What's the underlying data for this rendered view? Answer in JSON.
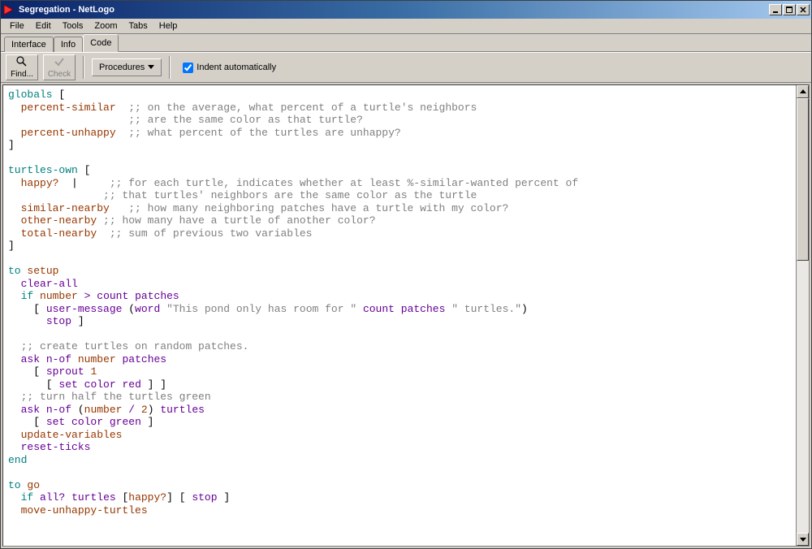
{
  "window": {
    "title": "Segregation - NetLogo"
  },
  "menus": [
    "File",
    "Edit",
    "Tools",
    "Zoom",
    "Tabs",
    "Help"
  ],
  "tabs": {
    "items": [
      "Interface",
      "Info",
      "Code"
    ],
    "active": "Code"
  },
  "toolbar": {
    "find": "Find...",
    "check": "Check",
    "procedures": "Procedures",
    "indent_label": "Indent automatically",
    "indent_checked": true
  },
  "code": {
    "lines": [
      [
        [
          "kw1",
          "globals"
        ],
        [
          "",
          ""
        ],
        [
          "",
          " ["
        ]
      ],
      [
        [
          "",
          "  "
        ],
        [
          "lit",
          "percent-similar"
        ],
        [
          "",
          "  "
        ],
        [
          "com",
          ";; on the average, what percent of a turtle's neighbors"
        ]
      ],
      [
        [
          "",
          "                   "
        ],
        [
          "com",
          ";; are the same color as that turtle?"
        ]
      ],
      [
        [
          "",
          "  "
        ],
        [
          "lit",
          "percent-unhappy"
        ],
        [
          "",
          "  "
        ],
        [
          "com",
          ";; what percent of the turtles are unhappy?"
        ]
      ],
      [
        [
          "",
          "]"
        ]
      ],
      [
        [
          "",
          ""
        ]
      ],
      [
        [
          "kw1",
          "turtles-own"
        ],
        [
          "",
          " ["
        ]
      ],
      [
        [
          "",
          "  "
        ],
        [
          "lit",
          "happy?"
        ],
        [
          "",
          "  |     "
        ],
        [
          "com",
          ";; for each turtle, indicates whether at least %-similar-wanted percent of"
        ]
      ],
      [
        [
          "",
          "               "
        ],
        [
          "com",
          ";; that turtles' neighbors are the same color as the turtle"
        ]
      ],
      [
        [
          "",
          "  "
        ],
        [
          "lit",
          "similar-nearby"
        ],
        [
          "",
          "   "
        ],
        [
          "com",
          ";; how many neighboring patches have a turtle with my color?"
        ]
      ],
      [
        [
          "",
          "  "
        ],
        [
          "lit",
          "other-nearby"
        ],
        [
          "",
          " "
        ],
        [
          "com",
          ";; how many have a turtle of another color?"
        ]
      ],
      [
        [
          "",
          "  "
        ],
        [
          "lit",
          "total-nearby"
        ],
        [
          "",
          "  "
        ],
        [
          "com",
          ";; sum of previous two variables"
        ]
      ],
      [
        [
          "",
          "]"
        ]
      ],
      [
        [
          "",
          ""
        ]
      ],
      [
        [
          "kw1",
          "to"
        ],
        [
          "",
          " "
        ],
        [
          "lit",
          "setup"
        ]
      ],
      [
        [
          "",
          "  "
        ],
        [
          "var",
          "clear-all"
        ]
      ],
      [
        [
          "",
          "  "
        ],
        [
          "kw1",
          "if"
        ],
        [
          "",
          " "
        ],
        [
          "lit",
          "number"
        ],
        [
          "",
          " "
        ],
        [
          "var",
          ">"
        ],
        [
          "",
          " "
        ],
        [
          "var",
          "count"
        ],
        [
          "",
          " "
        ],
        [
          "var",
          "patches"
        ]
      ],
      [
        [
          "",
          "    [ "
        ],
        [
          "var",
          "user-message"
        ],
        [
          "",
          " ("
        ],
        [
          "var",
          "word"
        ],
        [
          "",
          " "
        ],
        [
          "str",
          "\"This pond only has room for \""
        ],
        [
          "",
          " "
        ],
        [
          "var",
          "count"
        ],
        [
          "",
          " "
        ],
        [
          "var",
          "patches"
        ],
        [
          "",
          " "
        ],
        [
          "str",
          "\" turtles.\""
        ],
        [
          "",
          ")"
        ]
      ],
      [
        [
          "",
          "      "
        ],
        [
          "var",
          "stop"
        ],
        [
          "",
          " ]"
        ]
      ],
      [
        [
          "",
          ""
        ]
      ],
      [
        [
          "",
          "  "
        ],
        [
          "com",
          ";; create turtles on random patches."
        ]
      ],
      [
        [
          "",
          "  "
        ],
        [
          "var",
          "ask"
        ],
        [
          "",
          " "
        ],
        [
          "var",
          "n-of"
        ],
        [
          "",
          " "
        ],
        [
          "lit",
          "number"
        ],
        [
          "",
          " "
        ],
        [
          "var",
          "patches"
        ]
      ],
      [
        [
          "",
          "    [ "
        ],
        [
          "var",
          "sprout"
        ],
        [
          "",
          " "
        ],
        [
          "num",
          "1"
        ]
      ],
      [
        [
          "",
          "      [ "
        ],
        [
          "var",
          "set"
        ],
        [
          "",
          " "
        ],
        [
          "var",
          "color"
        ],
        [
          "",
          " "
        ],
        [
          "var",
          "red"
        ],
        [
          "",
          " ] ]"
        ]
      ],
      [
        [
          "",
          "  "
        ],
        [
          "com",
          ";; turn half the turtles green"
        ]
      ],
      [
        [
          "",
          "  "
        ],
        [
          "var",
          "ask"
        ],
        [
          "",
          " "
        ],
        [
          "var",
          "n-of"
        ],
        [
          "",
          " ("
        ],
        [
          "lit",
          "number"
        ],
        [
          "",
          " "
        ],
        [
          "var",
          "/"
        ],
        [
          "",
          " "
        ],
        [
          "num",
          "2"
        ],
        [
          "",
          ") "
        ],
        [
          "var",
          "turtles"
        ]
      ],
      [
        [
          "",
          "    [ "
        ],
        [
          "var",
          "set"
        ],
        [
          "",
          " "
        ],
        [
          "var",
          "color"
        ],
        [
          "",
          " "
        ],
        [
          "var",
          "green"
        ],
        [
          "",
          " ]"
        ]
      ],
      [
        [
          "",
          "  "
        ],
        [
          "lit",
          "update-variables"
        ]
      ],
      [
        [
          "",
          "  "
        ],
        [
          "var",
          "reset-ticks"
        ]
      ],
      [
        [
          "kw1",
          "end"
        ]
      ],
      [
        [
          "",
          ""
        ]
      ],
      [
        [
          "kw1",
          "to"
        ],
        [
          "",
          " "
        ],
        [
          "lit",
          "go"
        ]
      ],
      [
        [
          "",
          "  "
        ],
        [
          "kw1",
          "if"
        ],
        [
          "",
          " "
        ],
        [
          "var",
          "all?"
        ],
        [
          "",
          " "
        ],
        [
          "var",
          "turtles"
        ],
        [
          "",
          " ["
        ],
        [
          "lit",
          "happy?"
        ],
        [
          "",
          "] [ "
        ],
        [
          "var",
          "stop"
        ],
        [
          "",
          " ]"
        ]
      ],
      [
        [
          "",
          "  "
        ],
        [
          "lit",
          "move-unhappy-turtles"
        ]
      ]
    ]
  }
}
